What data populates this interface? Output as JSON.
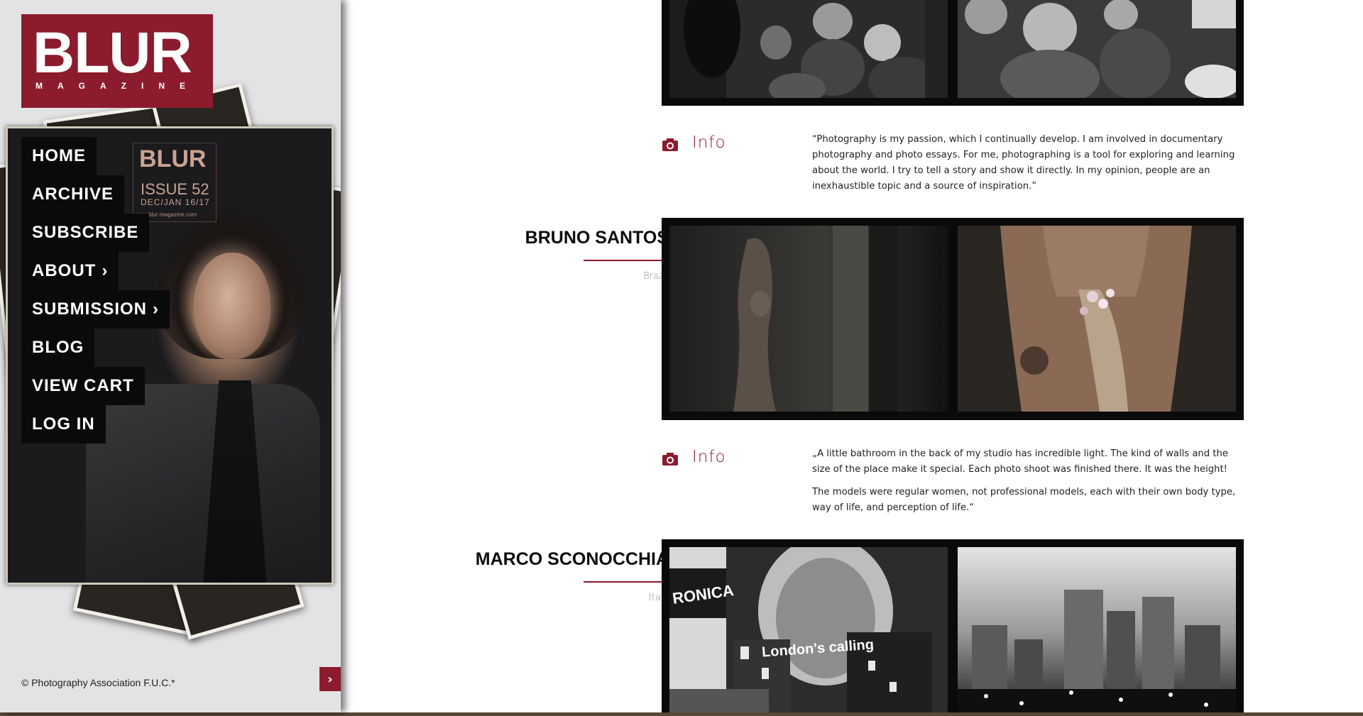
{
  "brand": {
    "logo_main": "BLUR",
    "logo_sub": "MAGAZINE",
    "color": "#8c1b2e"
  },
  "cover": {
    "title": "BLUR",
    "issue": "ISSUE 52",
    "date": "DEC/JAN 16/17",
    "url": "www.blur-magazine.com"
  },
  "nav": {
    "items": [
      {
        "label": "HOME",
        "has_submenu": false
      },
      {
        "label": "ARCHIVE",
        "has_submenu": false
      },
      {
        "label": "SUBSCRIBE",
        "has_submenu": false
      },
      {
        "label": "ABOUT",
        "has_submenu": true
      },
      {
        "label": "SUBMISSION",
        "has_submenu": true
      },
      {
        "label": "BLOG",
        "has_submenu": false
      },
      {
        "label": "VIEW CART",
        "has_submenu": false
      },
      {
        "label": "LOG IN",
        "has_submenu": false
      }
    ],
    "submenu_glyph": "›"
  },
  "footer": {
    "copyright": "© Photography Association F.U.C.*",
    "collapse_icon": "chevron-right-icon",
    "collapse_glyph": "›"
  },
  "gallery": {
    "info_label": "Info",
    "info_icon": "camera-icon",
    "entries": [
      {
        "artist": "",
        "country": "",
        "photos": [
          "crowd-photo-left",
          "crowd-photo-right"
        ],
        "info_paragraphs": [
          "“Photography is my passion, which I continually develop. I am involved in documentary photography and photo essays. For me, photographing is a tool for exploring and learning about the world. I try to tell a story and show it directly. In my opinion, people are an inexhaustible topic and a source of inspiration.”"
        ]
      },
      {
        "artist": "BRUNO SANTOS",
        "country": "Brazil",
        "photos": [
          "nude-doorway-photo",
          "flowers-tattoo-photo"
        ],
        "info_paragraphs": [
          "„A little bathroom in the back of my studio has incredible light. The kind of walls and the size of the place make it special. Each photo shoot was finished there. It was the height!",
          "The models were regular women, not professional models, each with their own body type, way of life, and perception of life.“"
        ]
      },
      {
        "artist": "MARCO SCONOCCHIA",
        "country": "Italy",
        "photos": [
          "london-collage-photo",
          "city-lights-photo"
        ],
        "photo_text": [
          "RONICA",
          "London's calling"
        ],
        "info_paragraphs": []
      }
    ]
  }
}
